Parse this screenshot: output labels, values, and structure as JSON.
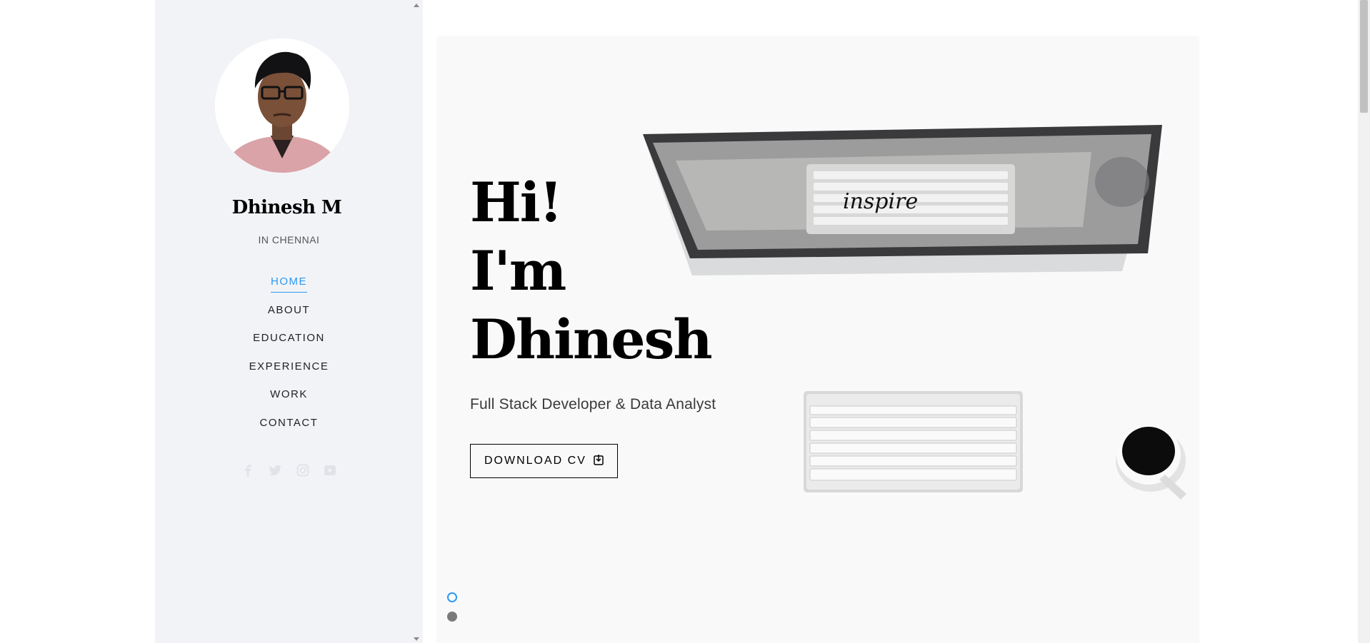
{
  "sidebar": {
    "name": "Dhinesh M",
    "location": "IN CHENNAI",
    "nav": [
      {
        "label": "HOME",
        "active": true
      },
      {
        "label": "ABOUT",
        "active": false
      },
      {
        "label": "EDUCATION",
        "active": false
      },
      {
        "label": "EXPERIENCE",
        "active": false
      },
      {
        "label": "WORK",
        "active": false
      },
      {
        "label": "CONTACT",
        "active": false
      }
    ],
    "social_icons": [
      "facebook-icon",
      "twitter-icon",
      "instagram-icon",
      "youtube-icon"
    ]
  },
  "hero": {
    "line1": "Hi!",
    "line2": "I'm",
    "line3": "Dhinesh",
    "subtitle": "Full Stack Developer & Data Analyst",
    "download_label": "DOWNLOAD CV",
    "screen_text": "inspire",
    "slides": {
      "count": 2,
      "active": 1
    }
  },
  "colors": {
    "accent": "#2c98f0",
    "sidebar_bg": "#f2f3f7",
    "text": "#000000"
  }
}
